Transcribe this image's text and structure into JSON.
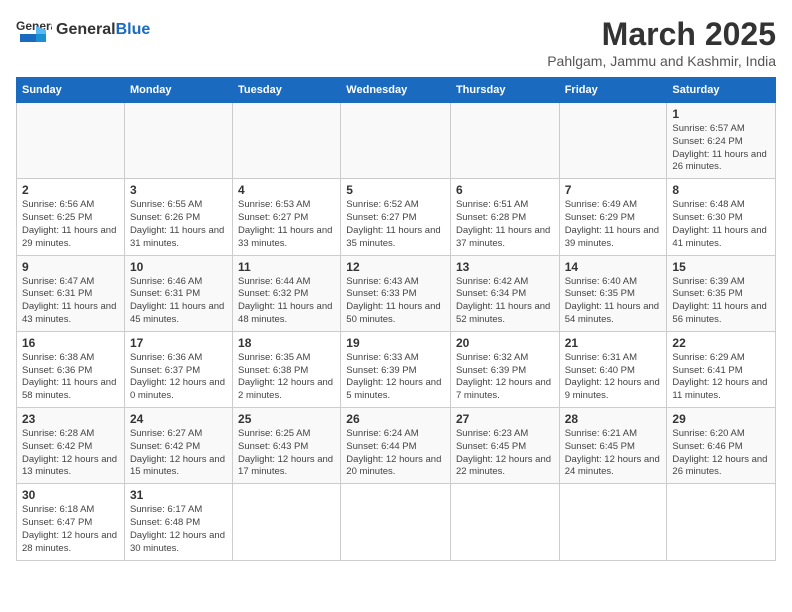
{
  "header": {
    "logo_general": "General",
    "logo_blue": "Blue",
    "month_title": "March 2025",
    "subtitle": "Pahlgam, Jammu and Kashmir, India"
  },
  "days_of_week": [
    "Sunday",
    "Monday",
    "Tuesday",
    "Wednesday",
    "Thursday",
    "Friday",
    "Saturday"
  ],
  "weeks": [
    [
      {
        "day": "",
        "info": ""
      },
      {
        "day": "",
        "info": ""
      },
      {
        "day": "",
        "info": ""
      },
      {
        "day": "",
        "info": ""
      },
      {
        "day": "",
        "info": ""
      },
      {
        "day": "",
        "info": ""
      },
      {
        "day": "1",
        "info": "Sunrise: 6:57 AM\nSunset: 6:24 PM\nDaylight: 11 hours and 26 minutes."
      }
    ],
    [
      {
        "day": "2",
        "info": "Sunrise: 6:56 AM\nSunset: 6:25 PM\nDaylight: 11 hours and 29 minutes."
      },
      {
        "day": "3",
        "info": "Sunrise: 6:55 AM\nSunset: 6:26 PM\nDaylight: 11 hours and 31 minutes."
      },
      {
        "day": "4",
        "info": "Sunrise: 6:53 AM\nSunset: 6:27 PM\nDaylight: 11 hours and 33 minutes."
      },
      {
        "day": "5",
        "info": "Sunrise: 6:52 AM\nSunset: 6:27 PM\nDaylight: 11 hours and 35 minutes."
      },
      {
        "day": "6",
        "info": "Sunrise: 6:51 AM\nSunset: 6:28 PM\nDaylight: 11 hours and 37 minutes."
      },
      {
        "day": "7",
        "info": "Sunrise: 6:49 AM\nSunset: 6:29 PM\nDaylight: 11 hours and 39 minutes."
      },
      {
        "day": "8",
        "info": "Sunrise: 6:48 AM\nSunset: 6:30 PM\nDaylight: 11 hours and 41 minutes."
      }
    ],
    [
      {
        "day": "9",
        "info": "Sunrise: 6:47 AM\nSunset: 6:31 PM\nDaylight: 11 hours and 43 minutes."
      },
      {
        "day": "10",
        "info": "Sunrise: 6:46 AM\nSunset: 6:31 PM\nDaylight: 11 hours and 45 minutes."
      },
      {
        "day": "11",
        "info": "Sunrise: 6:44 AM\nSunset: 6:32 PM\nDaylight: 11 hours and 48 minutes."
      },
      {
        "day": "12",
        "info": "Sunrise: 6:43 AM\nSunset: 6:33 PM\nDaylight: 11 hours and 50 minutes."
      },
      {
        "day": "13",
        "info": "Sunrise: 6:42 AM\nSunset: 6:34 PM\nDaylight: 11 hours and 52 minutes."
      },
      {
        "day": "14",
        "info": "Sunrise: 6:40 AM\nSunset: 6:35 PM\nDaylight: 11 hours and 54 minutes."
      },
      {
        "day": "15",
        "info": "Sunrise: 6:39 AM\nSunset: 6:35 PM\nDaylight: 11 hours and 56 minutes."
      }
    ],
    [
      {
        "day": "16",
        "info": "Sunrise: 6:38 AM\nSunset: 6:36 PM\nDaylight: 11 hours and 58 minutes."
      },
      {
        "day": "17",
        "info": "Sunrise: 6:36 AM\nSunset: 6:37 PM\nDaylight: 12 hours and 0 minutes."
      },
      {
        "day": "18",
        "info": "Sunrise: 6:35 AM\nSunset: 6:38 PM\nDaylight: 12 hours and 2 minutes."
      },
      {
        "day": "19",
        "info": "Sunrise: 6:33 AM\nSunset: 6:39 PM\nDaylight: 12 hours and 5 minutes."
      },
      {
        "day": "20",
        "info": "Sunrise: 6:32 AM\nSunset: 6:39 PM\nDaylight: 12 hours and 7 minutes."
      },
      {
        "day": "21",
        "info": "Sunrise: 6:31 AM\nSunset: 6:40 PM\nDaylight: 12 hours and 9 minutes."
      },
      {
        "day": "22",
        "info": "Sunrise: 6:29 AM\nSunset: 6:41 PM\nDaylight: 12 hours and 11 minutes."
      }
    ],
    [
      {
        "day": "23",
        "info": "Sunrise: 6:28 AM\nSunset: 6:42 PM\nDaylight: 12 hours and 13 minutes."
      },
      {
        "day": "24",
        "info": "Sunrise: 6:27 AM\nSunset: 6:42 PM\nDaylight: 12 hours and 15 minutes."
      },
      {
        "day": "25",
        "info": "Sunrise: 6:25 AM\nSunset: 6:43 PM\nDaylight: 12 hours and 17 minutes."
      },
      {
        "day": "26",
        "info": "Sunrise: 6:24 AM\nSunset: 6:44 PM\nDaylight: 12 hours and 20 minutes."
      },
      {
        "day": "27",
        "info": "Sunrise: 6:23 AM\nSunset: 6:45 PM\nDaylight: 12 hours and 22 minutes."
      },
      {
        "day": "28",
        "info": "Sunrise: 6:21 AM\nSunset: 6:45 PM\nDaylight: 12 hours and 24 minutes."
      },
      {
        "day": "29",
        "info": "Sunrise: 6:20 AM\nSunset: 6:46 PM\nDaylight: 12 hours and 26 minutes."
      }
    ],
    [
      {
        "day": "30",
        "info": "Sunrise: 6:18 AM\nSunset: 6:47 PM\nDaylight: 12 hours and 28 minutes."
      },
      {
        "day": "31",
        "info": "Sunrise: 6:17 AM\nSunset: 6:48 PM\nDaylight: 12 hours and 30 minutes."
      },
      {
        "day": "",
        "info": ""
      },
      {
        "day": "",
        "info": ""
      },
      {
        "day": "",
        "info": ""
      },
      {
        "day": "",
        "info": ""
      },
      {
        "day": "",
        "info": ""
      }
    ]
  ]
}
